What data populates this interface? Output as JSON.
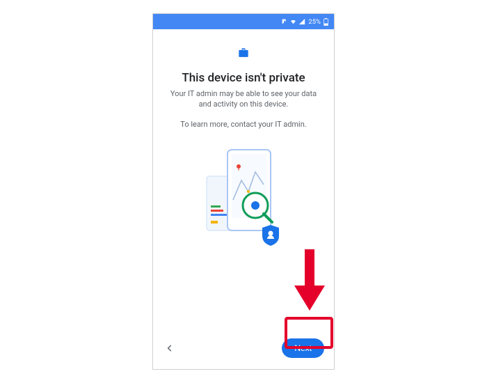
{
  "statusbar": {
    "battery_text": "25%"
  },
  "screen": {
    "title": "This device isn't private",
    "subtitle": "Your IT admin may be able to see your data and activity on this device.",
    "learn_more": "To learn more, contact your IT admin."
  },
  "actions": {
    "next_label": "Next"
  },
  "annotation": {
    "arrow_color": "#e4002b",
    "highlight_color": "#e4002b"
  }
}
